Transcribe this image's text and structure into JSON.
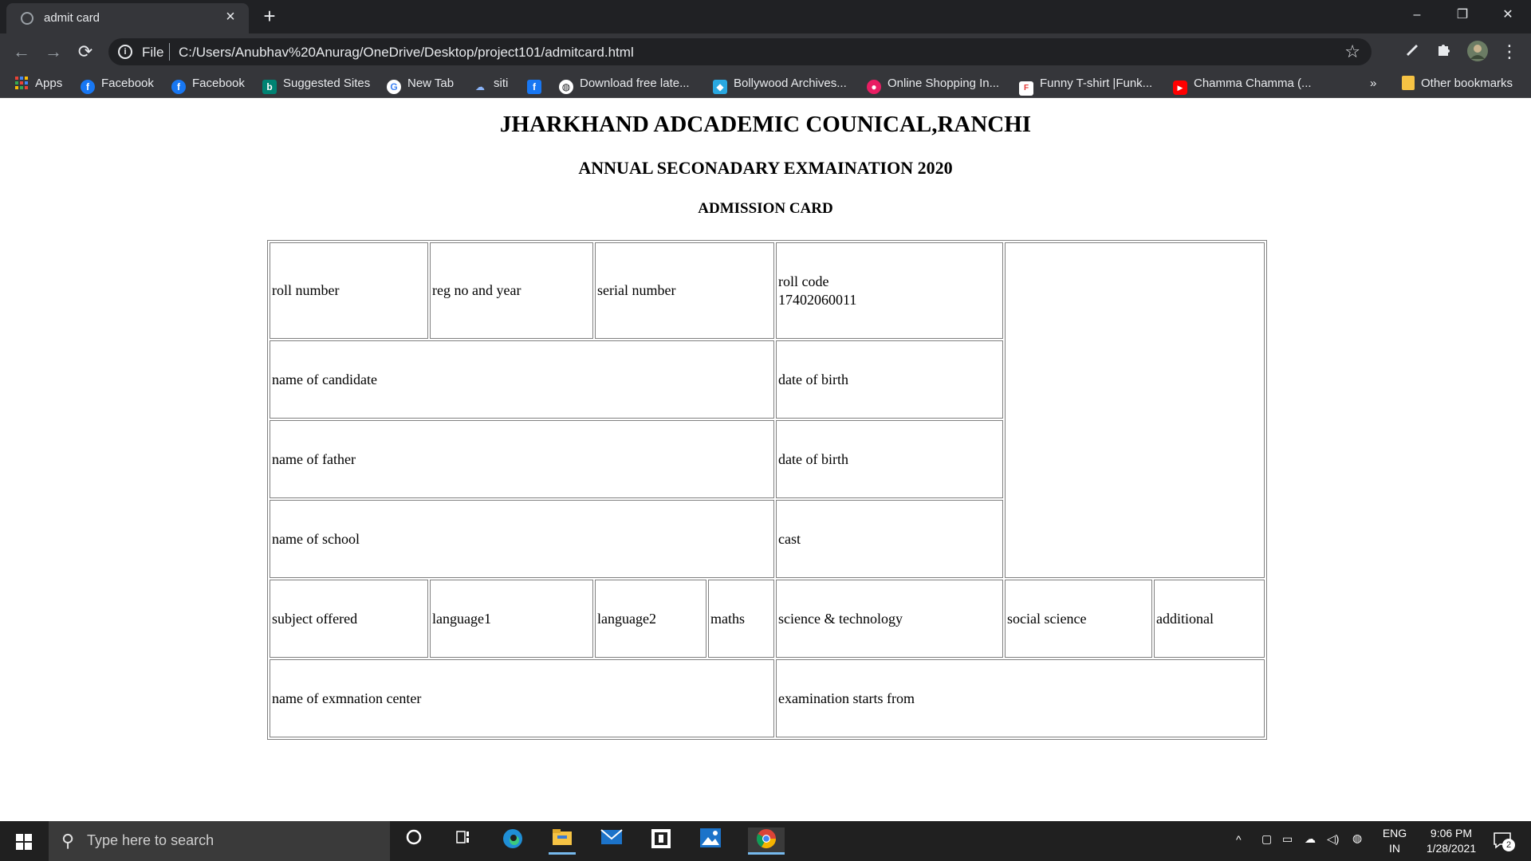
{
  "browser": {
    "tab_title": "admit card",
    "close_symbol": "×",
    "new_tab_symbol": "+",
    "scheme_label": "File",
    "url": "C:/Users/Anubhav%20Anurag/OneDrive/Desktop/project101/admitcard.html",
    "window_controls": {
      "minimize": "–",
      "restore": "❐",
      "close": "✕"
    },
    "nav_icons": {
      "back": "←",
      "forward": "→",
      "reload": "⟳",
      "bookmark_star": "☆",
      "info": "i"
    }
  },
  "bookmarks": {
    "items": [
      {
        "label": "Apps",
        "icon": "apps-grid-icon",
        "color": "#4285f4"
      },
      {
        "label": "Facebook",
        "icon": "facebook-icon",
        "color": "#1877f2"
      },
      {
        "label": "Facebook",
        "icon": "facebook-icon",
        "color": "#1877f2"
      },
      {
        "label": "Suggested Sites",
        "icon": "bing-icon",
        "color": "#008373"
      },
      {
        "label": "New Tab",
        "icon": "google-icon",
        "color": "#ffffff"
      },
      {
        "label": "siti",
        "icon": "cloud-icon",
        "color": "#8ab4f8"
      },
      {
        "label": "",
        "icon": "facebook-icon",
        "color": "#1877f2"
      },
      {
        "label": "Download free late...",
        "icon": "globe-icon",
        "color": "#ffffff"
      },
      {
        "label": "Bollywood Archives...",
        "icon": "site-icon",
        "color": "#29a8e0"
      },
      {
        "label": "Online Shopping In...",
        "icon": "shopping-icon",
        "color": "#e91e63"
      },
      {
        "label": "Funny T-shirt |Funk...",
        "icon": "funky-icon",
        "color": "#ffffff"
      },
      {
        "label": "Chamma Chamma (...",
        "icon": "youtube-icon",
        "color": "#ff0000"
      }
    ],
    "overflow": "»",
    "other_bookmarks": "Other bookmarks"
  },
  "page": {
    "title": "JHARKHAND ADCADEMIC COUNICAL,RANCHI",
    "subtitle": "ANNUAL SECONADARY EXMAINATION 2020",
    "card_title": "ADMISSION CARD",
    "table": {
      "roll_number": "roll number",
      "reg_no_and_year": "reg no and year",
      "serial_number": "serial number",
      "roll_code_label": "roll code",
      "roll_code_value": "17402060011",
      "name_of_candidate": "name of candidate",
      "date_of_birth_1": "date of birth",
      "name_of_father": "name of father",
      "date_of_birth_2": "date of birth",
      "name_of_school": "name of school",
      "cast": "cast",
      "subject_offered": "subject offered",
      "subjects": [
        "language1",
        "language2",
        "maths",
        "science & technology",
        "social science",
        "additional"
      ],
      "exam_center": "name of exmnation center",
      "exam_starts": "examination starts from"
    }
  },
  "taskbar": {
    "search_placeholder": "Type here to search",
    "language": "ENG",
    "region": "IN",
    "time": "9:06 PM",
    "date": "1/28/2021",
    "notification_count": "2"
  }
}
